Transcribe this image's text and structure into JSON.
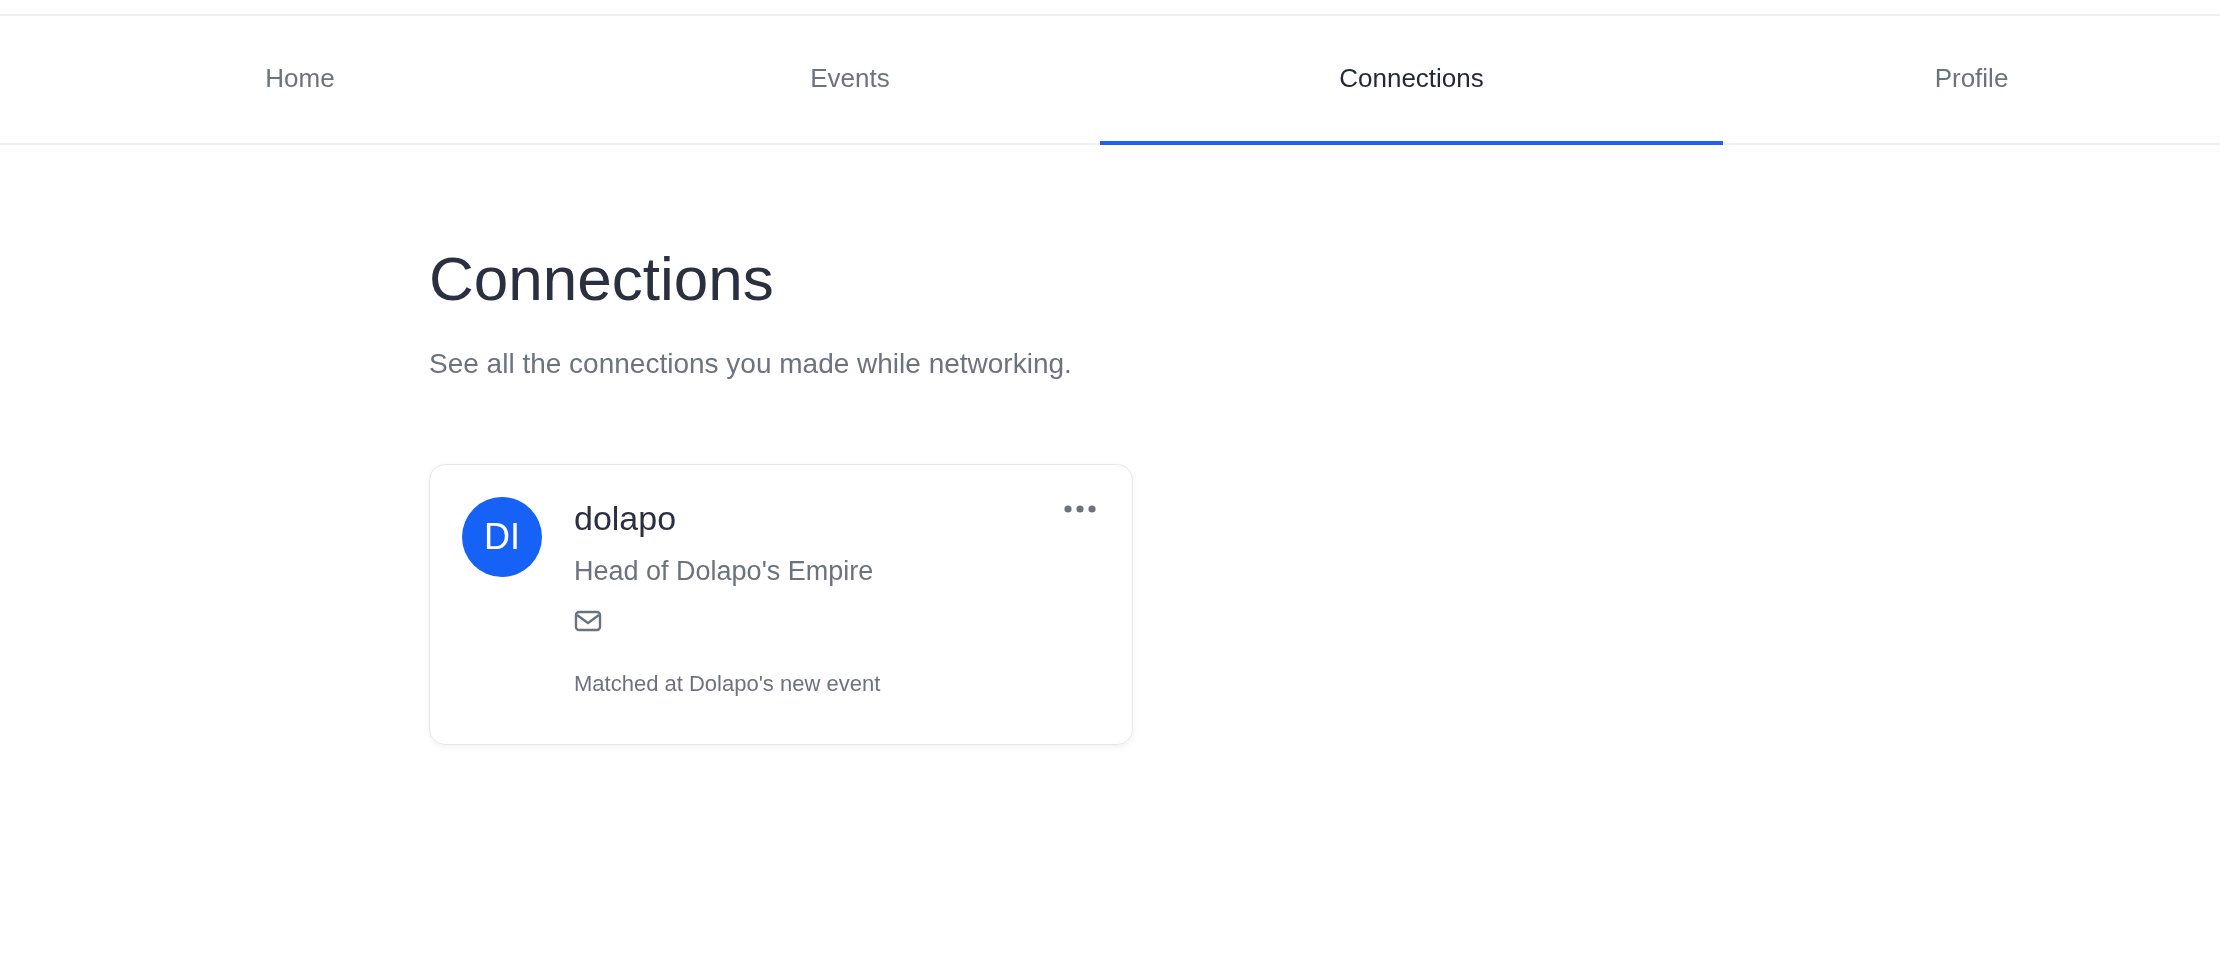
{
  "tabs": [
    {
      "label": "Home",
      "selected": false
    },
    {
      "label": "Events",
      "selected": false
    },
    {
      "label": "Connections",
      "selected": true
    },
    {
      "label": "Profile",
      "selected": false
    }
  ],
  "page": {
    "title": "Connections",
    "subtitle": "See all the connections you made while networking."
  },
  "connections": [
    {
      "initials": "DI",
      "name": "dolapo",
      "headline": "Head of Dolapo's Empire",
      "matched": "Matched at Dolapo's new event"
    }
  ]
}
